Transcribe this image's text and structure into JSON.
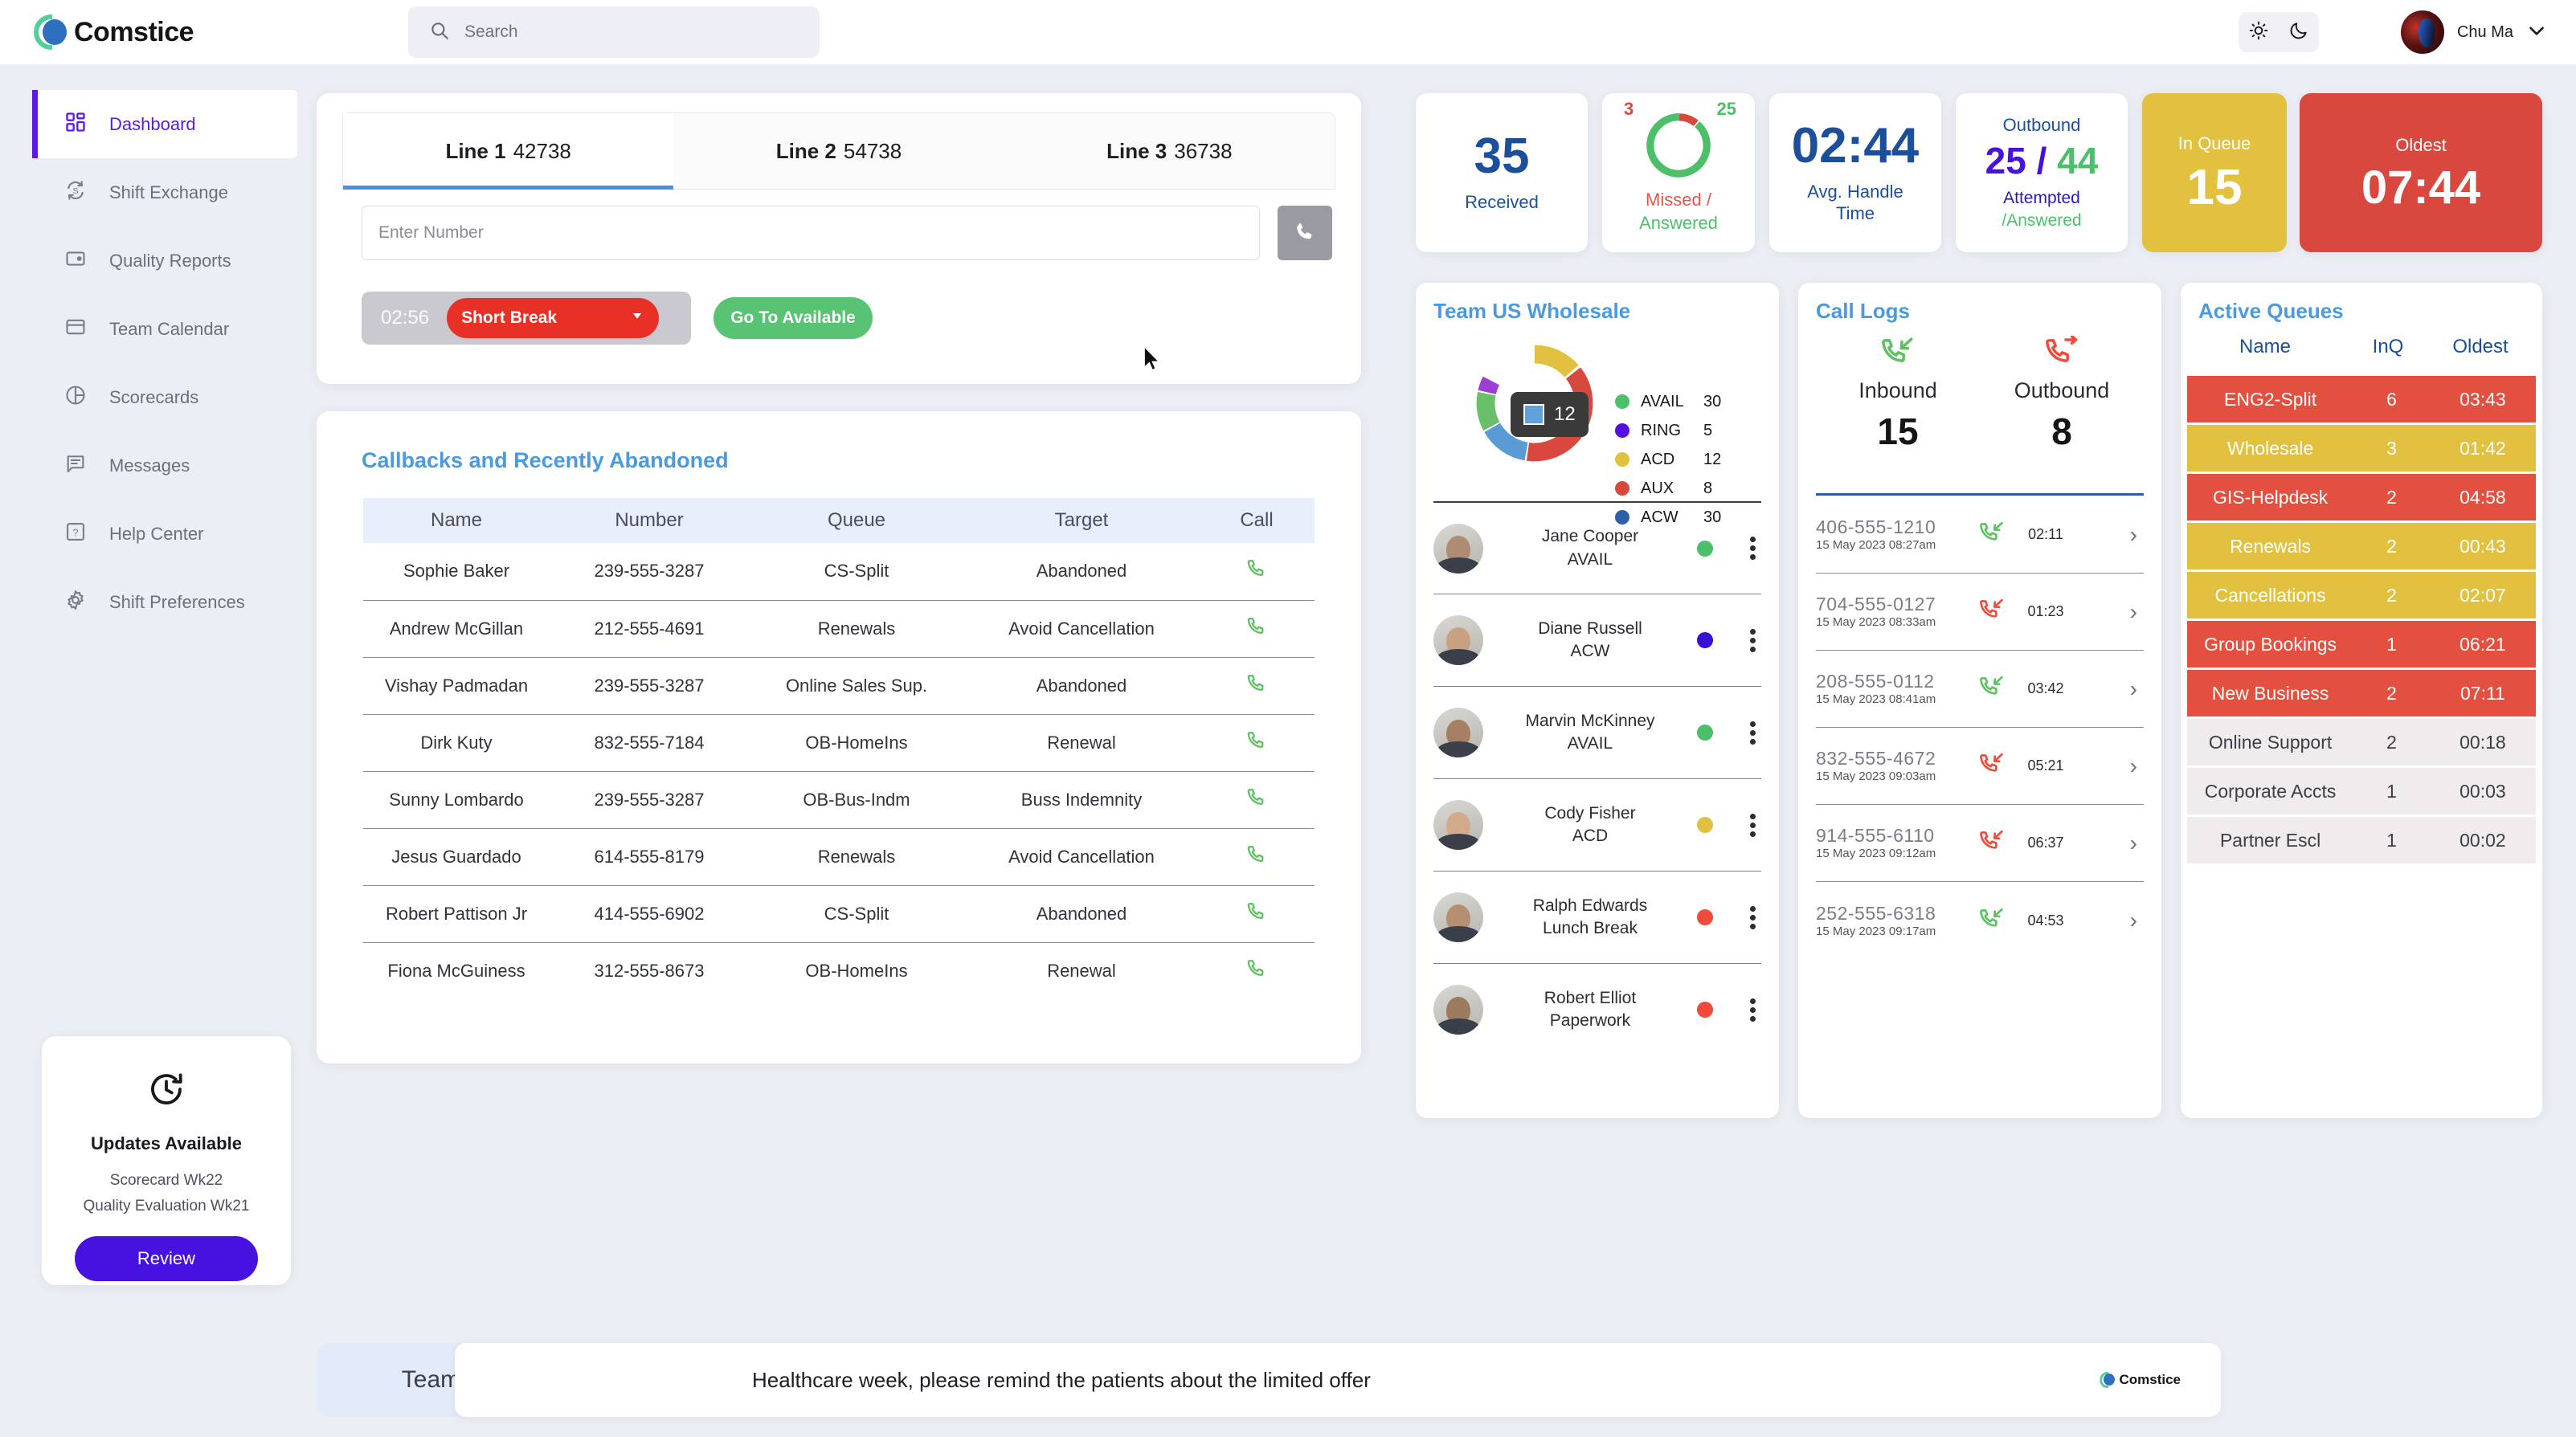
{
  "brand": {
    "name": "Comstice",
    "accent": "#5b1ae8",
    "blue": "#4b9ae0"
  },
  "header": {
    "search": {
      "placeholder": "Search",
      "value": "",
      "icon": "search-icon"
    },
    "theme": {
      "light_icon": "sun-icon",
      "dark_icon": "moon-icon"
    },
    "user": {
      "name": "Chu Ma",
      "caret_icon": "chevron-down-icon"
    }
  },
  "sidebar": {
    "items": [
      {
        "label": "Dashboard",
        "icon": "grid-icon",
        "active": true
      },
      {
        "label": "Shift Exchange",
        "icon": "swap-icon",
        "active": false
      },
      {
        "label": "Quality Reports",
        "icon": "report-icon",
        "active": false
      },
      {
        "label": "Team Calendar",
        "icon": "calendar-icon",
        "active": false
      },
      {
        "label": "Scorecards",
        "icon": "pie-icon",
        "active": false
      },
      {
        "label": "Messages",
        "icon": "message-icon",
        "active": false
      },
      {
        "label": "Help Center",
        "icon": "help-icon",
        "active": false
      },
      {
        "label": "Shift Preferences",
        "icon": "gear-icon",
        "active": false
      }
    ]
  },
  "updates": {
    "icon": "history-icon",
    "title": "Updates Available",
    "line1": "Scorecard Wk22",
    "line2": "Quality Evaluation Wk21",
    "button": "Review"
  },
  "dialer": {
    "tabs": [
      {
        "name": "Line 1",
        "number": "42738",
        "active": true
      },
      {
        "name": "Line 2",
        "number": "54738",
        "active": false
      },
      {
        "name": "Line 3",
        "number": "36738",
        "active": false
      }
    ],
    "number_placeholder": "Enter Number",
    "number_value": "",
    "call_icon": "phone-icon",
    "timer": "02:56",
    "status": "Short Break",
    "status_caret": "caret-down-icon",
    "available_button": "Go To Available"
  },
  "callbacks": {
    "title": "Callbacks and Recently Abandoned",
    "columns": [
      "Name",
      "Number",
      "Queue",
      "Target",
      "Call"
    ],
    "rows": [
      {
        "name": "Sophie Baker",
        "number": "239-555-3287",
        "queue": "CS-Split",
        "target": "Abandoned",
        "abandoned": true
      },
      {
        "name": "Andrew McGillan",
        "number": "212-555-4691",
        "queue": "Renewals",
        "target": "Avoid Cancellation",
        "abandoned": false
      },
      {
        "name": "Vishay Padmadan",
        "number": "239-555-3287",
        "queue": "Online Sales Sup.",
        "target": "Abandoned",
        "abandoned": true
      },
      {
        "name": "Dirk Kuty",
        "number": "832-555-7184",
        "queue": "OB-HomeIns",
        "target": "Renewal",
        "abandoned": false
      },
      {
        "name": "Sunny Lombardo",
        "number": "239-555-3287",
        "queue": "OB-Bus-Indm",
        "target": "Buss Indemnity",
        "abandoned": false
      },
      {
        "name": "Jesus Guardado",
        "number": "614-555-8179",
        "queue": "Renewals",
        "target": "Avoid Cancellation",
        "abandoned": false
      },
      {
        "name": "Robert Pattison Jr",
        "number": "414-555-6902",
        "queue": "CS-Split",
        "target": "Abandoned",
        "abandoned": true
      },
      {
        "name": "Fiona McGuiness",
        "number": "312-555-8673",
        "queue": "OB-HomeIns",
        "target": "Renewal",
        "abandoned": false
      }
    ]
  },
  "kpis": {
    "received": {
      "value": "35",
      "label": "Received"
    },
    "missed": {
      "missed": "3",
      "answered": "25",
      "label_missed": "Missed /",
      "label_answered": "Answered"
    },
    "aht": {
      "value": "02:44",
      "label_1": "Avg. Handle",
      "label_2": "Time"
    },
    "outbound": {
      "title": "Outbound",
      "attempted": "25",
      "slash": "/",
      "answered": "44",
      "sub_attempted": "Attempted",
      "sub_answered": "/Answered"
    },
    "in_queue": {
      "label": "In Queue",
      "value": "15",
      "color": "#e3c140"
    },
    "oldest": {
      "label": "Oldest",
      "value": "07:44",
      "color": "#d9483f"
    }
  },
  "team": {
    "title": "Team US Wholesale",
    "tooltip_value": "12",
    "legend": [
      {
        "name": "AVAIL",
        "value": "30",
        "color": "#4cbf6a"
      },
      {
        "name": "RING",
        "value": "5",
        "color": "#5211e0"
      },
      {
        "name": "ACD",
        "value": "12",
        "color": "#e3c140"
      },
      {
        "name": "AUX",
        "value": "8",
        "color": "#d9483f"
      },
      {
        "name": "ACW",
        "value": "30",
        "color": "#2b5fa8"
      }
    ],
    "agents": [
      {
        "name": "Jane Cooper",
        "state": "AVAIL",
        "color": "#4cbf6a"
      },
      {
        "name": "Diane Russell",
        "state": "ACW",
        "color": "#3a0fd6"
      },
      {
        "name": "Marvin McKinney",
        "state": "AVAIL",
        "color": "#4cbf6a"
      },
      {
        "name": "Cody Fisher",
        "state": "ACD",
        "color": "#e3c140"
      },
      {
        "name": "Ralph Edwards",
        "state": "Lunch Break",
        "color": "#ef4a3a"
      },
      {
        "name": "Robert Elliot",
        "state": "Paperwork",
        "color": "#ef4a3a"
      }
    ]
  },
  "call_logs": {
    "title": "Call Logs",
    "inbound": {
      "label": "Inbound",
      "value": "15",
      "icon": "call-inbound-icon"
    },
    "outbound": {
      "label": "Outbound",
      "value": "8",
      "icon": "call-outbound-icon"
    },
    "rows": [
      {
        "number": "406-555-1210",
        "time": "15 May 2023 08:27am",
        "dir": "in",
        "missed": false,
        "duration": "02:11"
      },
      {
        "number": "704-555-0127",
        "time": "15 May 2023 08:33am",
        "dir": "in",
        "missed": true,
        "duration": "01:23"
      },
      {
        "number": "208-555-0112",
        "time": "15 May 2023 08:41am",
        "dir": "in",
        "missed": false,
        "duration": "03:42"
      },
      {
        "number": "832-555-4672",
        "time": "15 May 2023 09:03am",
        "dir": "in",
        "missed": true,
        "duration": "05:21"
      },
      {
        "number": "914-555-6110",
        "time": "15 May 2023 09:12am",
        "dir": "in",
        "missed": true,
        "duration": "06:37"
      },
      {
        "number": "252-555-6318",
        "time": "15 May 2023 09:17am",
        "dir": "in",
        "missed": false,
        "duration": "04:53"
      }
    ]
  },
  "queues": {
    "title": "Active Queues",
    "columns": [
      "Name",
      "InQ",
      "Oldest"
    ],
    "rows": [
      {
        "name": "ENG2-Split",
        "inq": "6",
        "oldest": "03:43",
        "level": "red"
      },
      {
        "name": "Wholesale",
        "inq": "3",
        "oldest": "01:42",
        "level": "yellow"
      },
      {
        "name": "GIS-Helpdesk",
        "inq": "2",
        "oldest": "04:58",
        "level": "red"
      },
      {
        "name": "Renewals",
        "inq": "2",
        "oldest": "00:43",
        "level": "yellow"
      },
      {
        "name": "Cancellations",
        "inq": "2",
        "oldest": "02:07",
        "level": "yellow"
      },
      {
        "name": "Group Bookings",
        "inq": "1",
        "oldest": "06:21",
        "level": "red"
      },
      {
        "name": "New Business",
        "inq": "2",
        "oldest": "07:11",
        "level": "red"
      },
      {
        "name": "Online Support",
        "inq": "2",
        "oldest": "00:18",
        "level": "grey"
      },
      {
        "name": "Corporate Accts",
        "inq": "1",
        "oldest": "00:03",
        "level": "grey"
      },
      {
        "name": "Partner Escl",
        "inq": "1",
        "oldest": "00:02",
        "level": "grey"
      }
    ]
  },
  "team_messages": {
    "label": "Team Messages",
    "text": "Healthcare week, please remind the patients about the limited offer",
    "logo": "Comstice"
  },
  "chart_data": [
    {
      "type": "pie",
      "title": "Team US Wholesale agent states",
      "categories": [
        "AVAIL",
        "RING",
        "ACD",
        "AUX",
        "ACW"
      ],
      "values": [
        30,
        5,
        12,
        8,
        30
      ],
      "colors": [
        "#6abf69",
        "#9b3fd4",
        "#e3c140",
        "#d9483f",
        "#5a9bd5"
      ],
      "legend": "right",
      "annotation": "12"
    },
    {
      "type": "pie",
      "title": "Missed / Answered",
      "categories": [
        "Missed",
        "Answered"
      ],
      "values": [
        3,
        25
      ],
      "colors": [
        "#d9483f",
        "#4cbf6a"
      ],
      "legend": "none"
    }
  ]
}
